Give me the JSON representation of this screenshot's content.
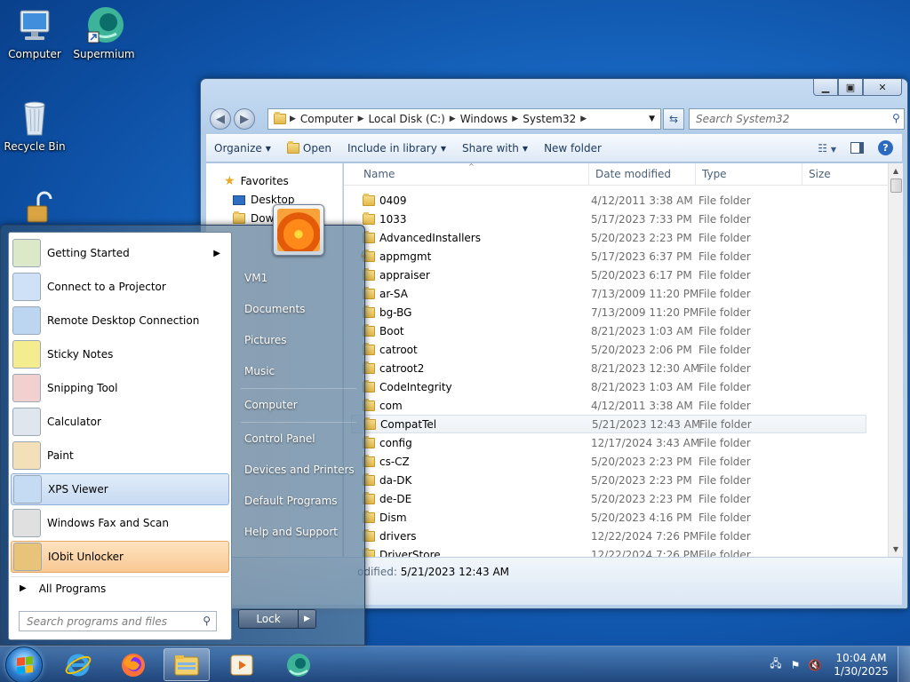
{
  "desktop": {
    "icons": [
      {
        "label": "Computer"
      },
      {
        "label": "Supermium"
      },
      {
        "label": "Recycle Bin"
      }
    ]
  },
  "explorer": {
    "breadcrumb": [
      "Computer",
      "Local Disk (C:)",
      "Windows",
      "System32"
    ],
    "search_placeholder": "Search System32",
    "toolbar": {
      "organize": "Organize",
      "open": "Open",
      "include": "Include in library",
      "share": "Share with",
      "new_folder": "New folder"
    },
    "nav": {
      "favorites": "Favorites",
      "desktop": "Desktop",
      "downloads": "Dow"
    },
    "columns": {
      "name": "Name",
      "date": "Date modified",
      "type": "Type",
      "size": "Size"
    },
    "rows": [
      {
        "name": "0409",
        "date": "4/12/2011 3:38 AM",
        "type": "File folder"
      },
      {
        "name": "1033",
        "date": "5/17/2023 7:33 PM",
        "type": "File folder"
      },
      {
        "name": "AdvancedInstallers",
        "date": "5/20/2023 2:23 PM",
        "type": "File folder"
      },
      {
        "name": "appmgmt",
        "date": "5/17/2023 6:37 PM",
        "type": "File folder"
      },
      {
        "name": "appraiser",
        "date": "5/20/2023 6:17 PM",
        "type": "File folder"
      },
      {
        "name": "ar-SA",
        "date": "7/13/2009 11:20 PM",
        "type": "File folder"
      },
      {
        "name": "bg-BG",
        "date": "7/13/2009 11:20 PM",
        "type": "File folder"
      },
      {
        "name": "Boot",
        "date": "8/21/2023 1:03 AM",
        "type": "File folder"
      },
      {
        "name": "catroot",
        "date": "5/20/2023 2:06 PM",
        "type": "File folder"
      },
      {
        "name": "catroot2",
        "date": "8/21/2023 12:30 AM",
        "type": "File folder"
      },
      {
        "name": "CodeIntegrity",
        "date": "8/21/2023 1:03 AM",
        "type": "File folder"
      },
      {
        "name": "com",
        "date": "4/12/2011 3:38 AM",
        "type": "File folder"
      },
      {
        "name": "CompatTel",
        "date": "5/21/2023 12:43 AM",
        "type": "File folder"
      },
      {
        "name": "config",
        "date": "12/17/2024 3:43 AM",
        "type": "File folder"
      },
      {
        "name": "cs-CZ",
        "date": "5/20/2023 2:23 PM",
        "type": "File folder"
      },
      {
        "name": "da-DK",
        "date": "5/20/2023 2:23 PM",
        "type": "File folder"
      },
      {
        "name": "de-DE",
        "date": "5/20/2023 2:23 PM",
        "type": "File folder"
      },
      {
        "name": "Dism",
        "date": "5/20/2023 4:16 PM",
        "type": "File folder"
      },
      {
        "name": "drivers",
        "date": "12/22/2024 7:26 PM",
        "type": "File folder"
      },
      {
        "name": "DriverStore",
        "date": "12/22/2024 7:26 PM",
        "type": "File folder"
      }
    ],
    "details_label": "odified:",
    "details_value": "5/21/2023 12:43 AM"
  },
  "start_menu": {
    "programs": [
      {
        "label": "Getting Started"
      },
      {
        "label": "Connect to a Projector"
      },
      {
        "label": "Remote Desktop Connection"
      },
      {
        "label": "Sticky Notes"
      },
      {
        "label": "Snipping Tool"
      },
      {
        "label": "Calculator"
      },
      {
        "label": "Paint"
      },
      {
        "label": "XPS Viewer"
      },
      {
        "label": "Windows Fax and Scan"
      },
      {
        "label": "IObit Unlocker"
      }
    ],
    "all_programs": "All Programs",
    "search_placeholder": "Search programs and files",
    "right_items": [
      {
        "label": "VM1"
      },
      {
        "label": "Documents"
      },
      {
        "label": "Pictures"
      },
      {
        "label": "Music"
      },
      {
        "label": "Computer"
      },
      {
        "label": "Control Panel"
      },
      {
        "label": "Devices and Printers"
      },
      {
        "label": "Default Programs"
      },
      {
        "label": "Help and Support"
      }
    ],
    "lock_label": "Lock"
  },
  "taskbar": {
    "time": "10:04 AM",
    "date": "1/30/2025"
  }
}
